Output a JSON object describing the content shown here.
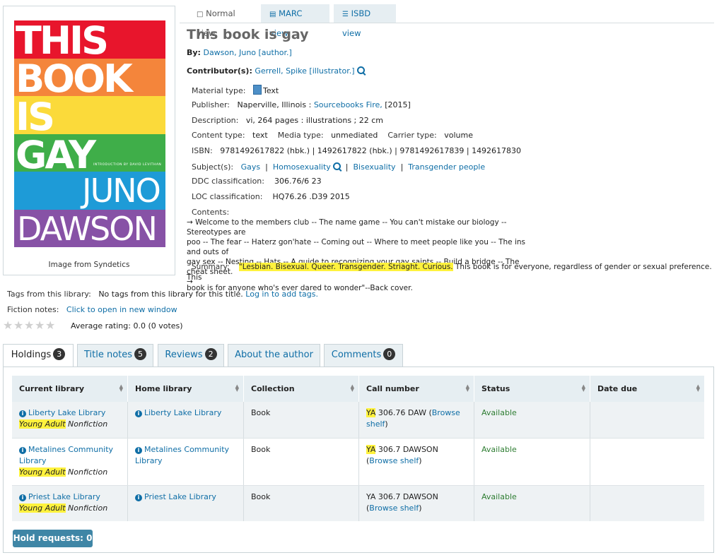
{
  "cover": {
    "words": [
      "THIS",
      "BOOK",
      "IS",
      "GAY"
    ],
    "author_lines": [
      "JUNO",
      "DAWSON"
    ],
    "intro": "INTRODUCTION BY DAVID LEVITHAN",
    "caption": "Image from Syndetics",
    "stripes": [
      "#e8152c",
      "#f4853b",
      "#fbda3a",
      "#3fae49",
      "#1e9bd7",
      "#8752a6"
    ]
  },
  "view_tabs": {
    "normal": "Normal view",
    "marc": "MARC view",
    "isbd": "ISBD view"
  },
  "record": {
    "title": "This book is gay",
    "by_label": "By:",
    "author": "Dawson, Juno [author.]",
    "contrib_label": "Contributor(s):",
    "contributor": "Gerrell, Spike [illustrator.]",
    "material_label": "Material type:",
    "material": "Text",
    "publisher_label": "Publisher:",
    "publisher_place": "Naperville, Illinois :",
    "publisher_name": "Sourcebooks Fire,",
    "publisher_year": "[2015]",
    "description_label": "Description:",
    "description": "vi, 264 pages : illustrations ; 22 cm",
    "content_type_label": "Content type:",
    "content_type": "text",
    "media_type_label": "Media type:",
    "media_type": "unmediated",
    "carrier_type_label": "Carrier type:",
    "carrier_type": "volume",
    "isbn_label": "ISBN:",
    "isbn": "9781492617822 (hbk.) | 1492617822 (hbk.) | 9781492617839 | 1492617830",
    "subjects_label": "Subject(s):",
    "subjects": [
      "Gays",
      "Homosexuality",
      "Bisexuality",
      "Transgender people"
    ],
    "ddc_label": "DDC classification:",
    "ddc": "306.76/6 23",
    "loc_label": "LOC classification:",
    "loc": "HQ76.26 .D39 2015",
    "contents_label": "Contents:",
    "contents_line1": "→ Welcome to the members club -- The name game -- You can't mistake our biology -- Stereotypes are",
    "contents_line2": "poo -- The fear -- Haterz gon'hate -- Coming out -- Where to meet people like you -- The ins and outs of",
    "contents_line3": "gay sex -- Nesting -- Hats -- A guide to recognizing your gay saints -- Build a bridge -- The cheat sheet.",
    "contents_line4": "→",
    "summary_label": "Summary:",
    "summary_highlight": "\"Lesbian. Bisexual. Queer. Transgender. Striaght. Curious.",
    "summary_rest1": " This book is for everyone, regardless of gender or sexual preference. This",
    "summary_rest2": "book is for anyone who's ever dared to wonder\"--Back cover."
  },
  "tags": {
    "label": "Tags from this library:",
    "text": "No tags from this library for this title.",
    "login_link": "Log in to add tags."
  },
  "fiction": {
    "label": "Fiction notes:",
    "link": "Click to open in new window"
  },
  "rating": {
    "text": "Average rating: 0.0 (0 votes)",
    "value": 0,
    "max": 5
  },
  "tabs": [
    {
      "label": "Holdings",
      "count": "3"
    },
    {
      "label": "Title notes",
      "count": "5"
    },
    {
      "label": "Reviews",
      "count": "2"
    },
    {
      "label": "About the author",
      "count": ""
    },
    {
      "label": "Comments",
      "count": "0"
    }
  ],
  "holdings": {
    "headers": [
      "Current library",
      "Home library",
      "Collection",
      "Call number",
      "Status",
      "Date due"
    ],
    "rows": [
      {
        "current": "Liberty Lake Library",
        "loc_hl": "Young Adult",
        "loc_rest": "Nonfiction",
        "home": "Liberty Lake Library",
        "collection": "Book",
        "call_hl": "YA",
        "call": " 306.76 DAW (",
        "browse": "Browse shelf",
        "call_end": ")",
        "status": "Available",
        "due": ""
      },
      {
        "current": "Metalines Community Library",
        "loc_hl": "Young Adult",
        "loc_rest": "Nonfiction",
        "home": "Metalines Community Library",
        "collection": "Book",
        "call_hl": "YA",
        "call": " 306.7 DAWSON",
        "browse": "Browse shelf",
        "call_end": ")",
        "status": "Available",
        "due": ""
      },
      {
        "current": "Priest Lake Library",
        "loc_hl": "Young Adult",
        "loc_rest": "Nonfiction",
        "home": "Priest Lake Library",
        "collection": "Book",
        "call_hl": "",
        "call": "YA 306.7 DAWSON",
        "browse": "Browse shelf",
        "call_end": ")",
        "status": "Available",
        "due": ""
      }
    ]
  },
  "hold_requests": "Hold requests: 0"
}
